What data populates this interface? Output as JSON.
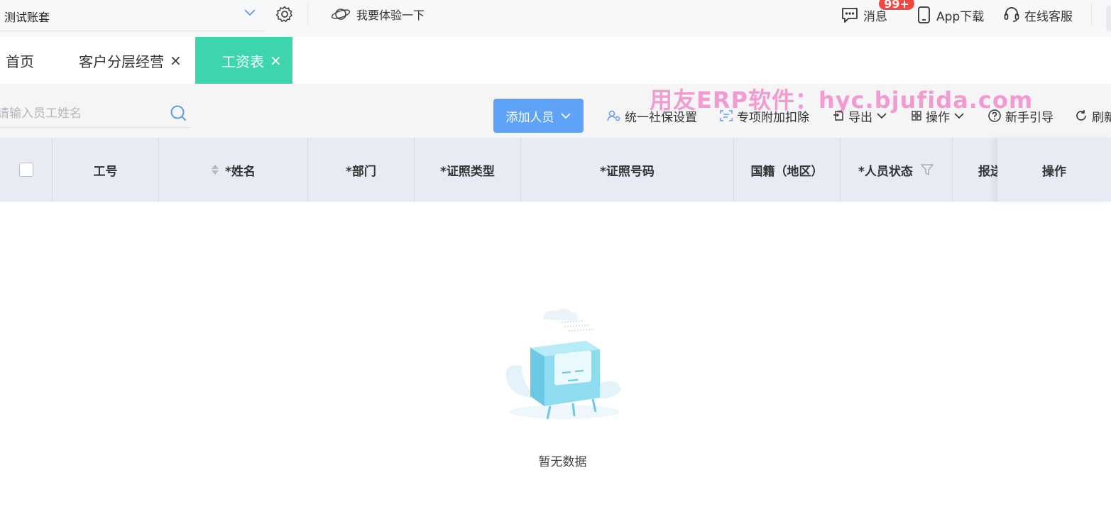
{
  "topbar": {
    "account": "测试账套",
    "try_label": "我要体验一下",
    "messages_label": "消息",
    "messages_badge": "99+",
    "app_label": "App下载",
    "service_label": "在线客服"
  },
  "tabs": [
    {
      "label": "首页",
      "closable": false,
      "active": false
    },
    {
      "label": "客户分层经营",
      "closable": true,
      "active": false
    },
    {
      "label": "工资表",
      "closable": true,
      "active": true
    }
  ],
  "tab_close_glyph": "×",
  "toolbar": {
    "search_placeholder": "请输入员工姓名",
    "add_label": "添加人员",
    "social_label": "统一社保设置",
    "deduction_label": "专项附加扣除",
    "export_label": "导出",
    "ops_label": "操作",
    "guide_label": "新手引导",
    "refresh_label": "刷新"
  },
  "watermark": "用友ERP软件：hyc.bjufida.com",
  "table": {
    "columns": [
      "工号",
      "*姓名",
      "*部门",
      "*证照类型",
      "*证照号码",
      "国籍（地区）",
      "*人员状态",
      "报送"
    ],
    "fixed_column": "操作"
  },
  "empty_text": "暂无数据",
  "colors": {
    "accent_green": "#3dd5ae",
    "primary_blue": "#5ea3f7",
    "badge_red": "#f5463f",
    "header_bg": "#e8eaf4",
    "watermark_pink": "#f29bd2"
  }
}
